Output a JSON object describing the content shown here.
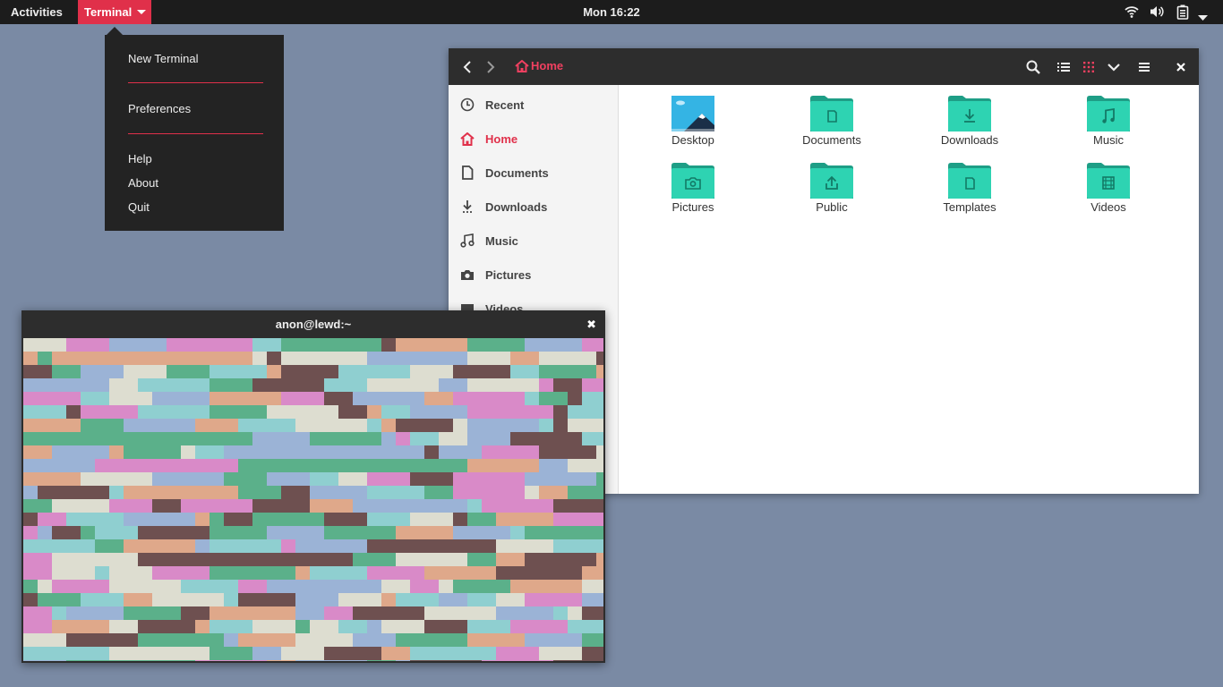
{
  "topbar": {
    "activities": "Activities",
    "app_name": "Terminal",
    "clock": "Mon 16:22"
  },
  "app_menu": {
    "items": [
      "New Terminal",
      "Preferences",
      "Help",
      "About",
      "Quit"
    ]
  },
  "files": {
    "path": "Home",
    "sidebar": [
      "Recent",
      "Home",
      "Documents",
      "Downloads",
      "Music",
      "Pictures",
      "Videos"
    ],
    "active_sidebar": "Home",
    "folders": [
      "Desktop",
      "Documents",
      "Downloads",
      "Music",
      "Pictures",
      "Public",
      "Templates",
      "Videos"
    ]
  },
  "terminal": {
    "title": "anon@lewd:~"
  },
  "colors": {
    "accent": "#e0304a",
    "folder": "#2ec6a8",
    "desktop_bg": "#7a8aa4",
    "pixel_palette": [
      "#5bb08a",
      "#8fcfd0",
      "#ddddd0",
      "#9bb3d6",
      "#6e5050",
      "#dfa88a",
      "#d98ac8"
    ]
  }
}
